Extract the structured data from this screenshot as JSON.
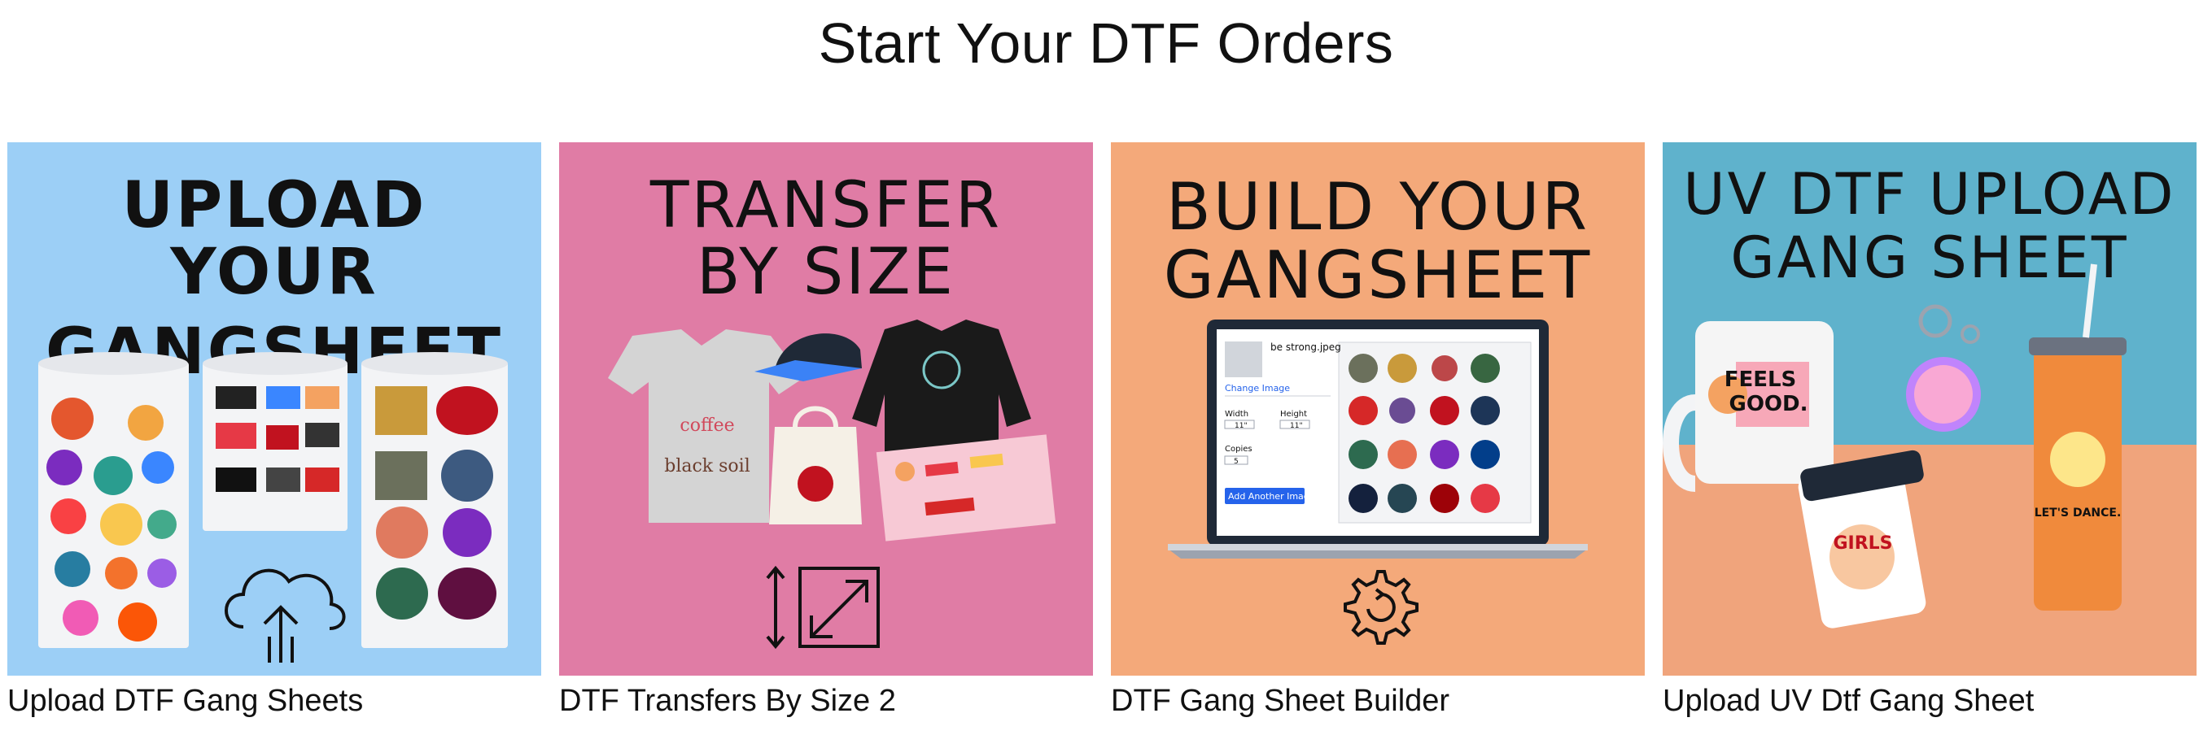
{
  "page": {
    "title": "Start Your DTF Orders"
  },
  "colors": {
    "card1_bg": "#9ccff6",
    "card2_bg": "#e07ca5",
    "card3_bg": "#f4a97a",
    "card4_top": "#5fb2cc",
    "card4_bottom": "#f0a47c"
  },
  "cards": [
    {
      "headline_line1": "UPLOAD YOUR",
      "headline_line2": "GANGSHEET",
      "caption": "Upload DTF Gang Sheets",
      "icon": "cloud-upload-icon"
    },
    {
      "headline_line1": "TRANSFER",
      "headline_line2": "BY SIZE",
      "caption": "DTF Transfers By Size 2",
      "icon": "resize-icon"
    },
    {
      "headline_line1": "BUILD YOUR",
      "headline_line2": "GANGSHEET",
      "caption": "DTF Gang Sheet Builder",
      "icon": "gear-refresh-icon",
      "laptop": {
        "file_name": "be strong.jpeg",
        "change_image": "Change Image",
        "width_label": "Width",
        "height_label": "Height",
        "width_value": "11\"",
        "height_value": "11\"",
        "copies_label": "Copies",
        "copies_value": "5",
        "add_button": "Add Another Image"
      }
    },
    {
      "headline_line1": "UV DTF UPLOAD",
      "headline_line2": "GANG SHEET",
      "caption": "Upload UV Dtf Gang Sheet",
      "mug_text": "FEELS GOOD.",
      "cup_text": "GIRLS",
      "tumbler_text": "LET'S DANCE"
    }
  ]
}
